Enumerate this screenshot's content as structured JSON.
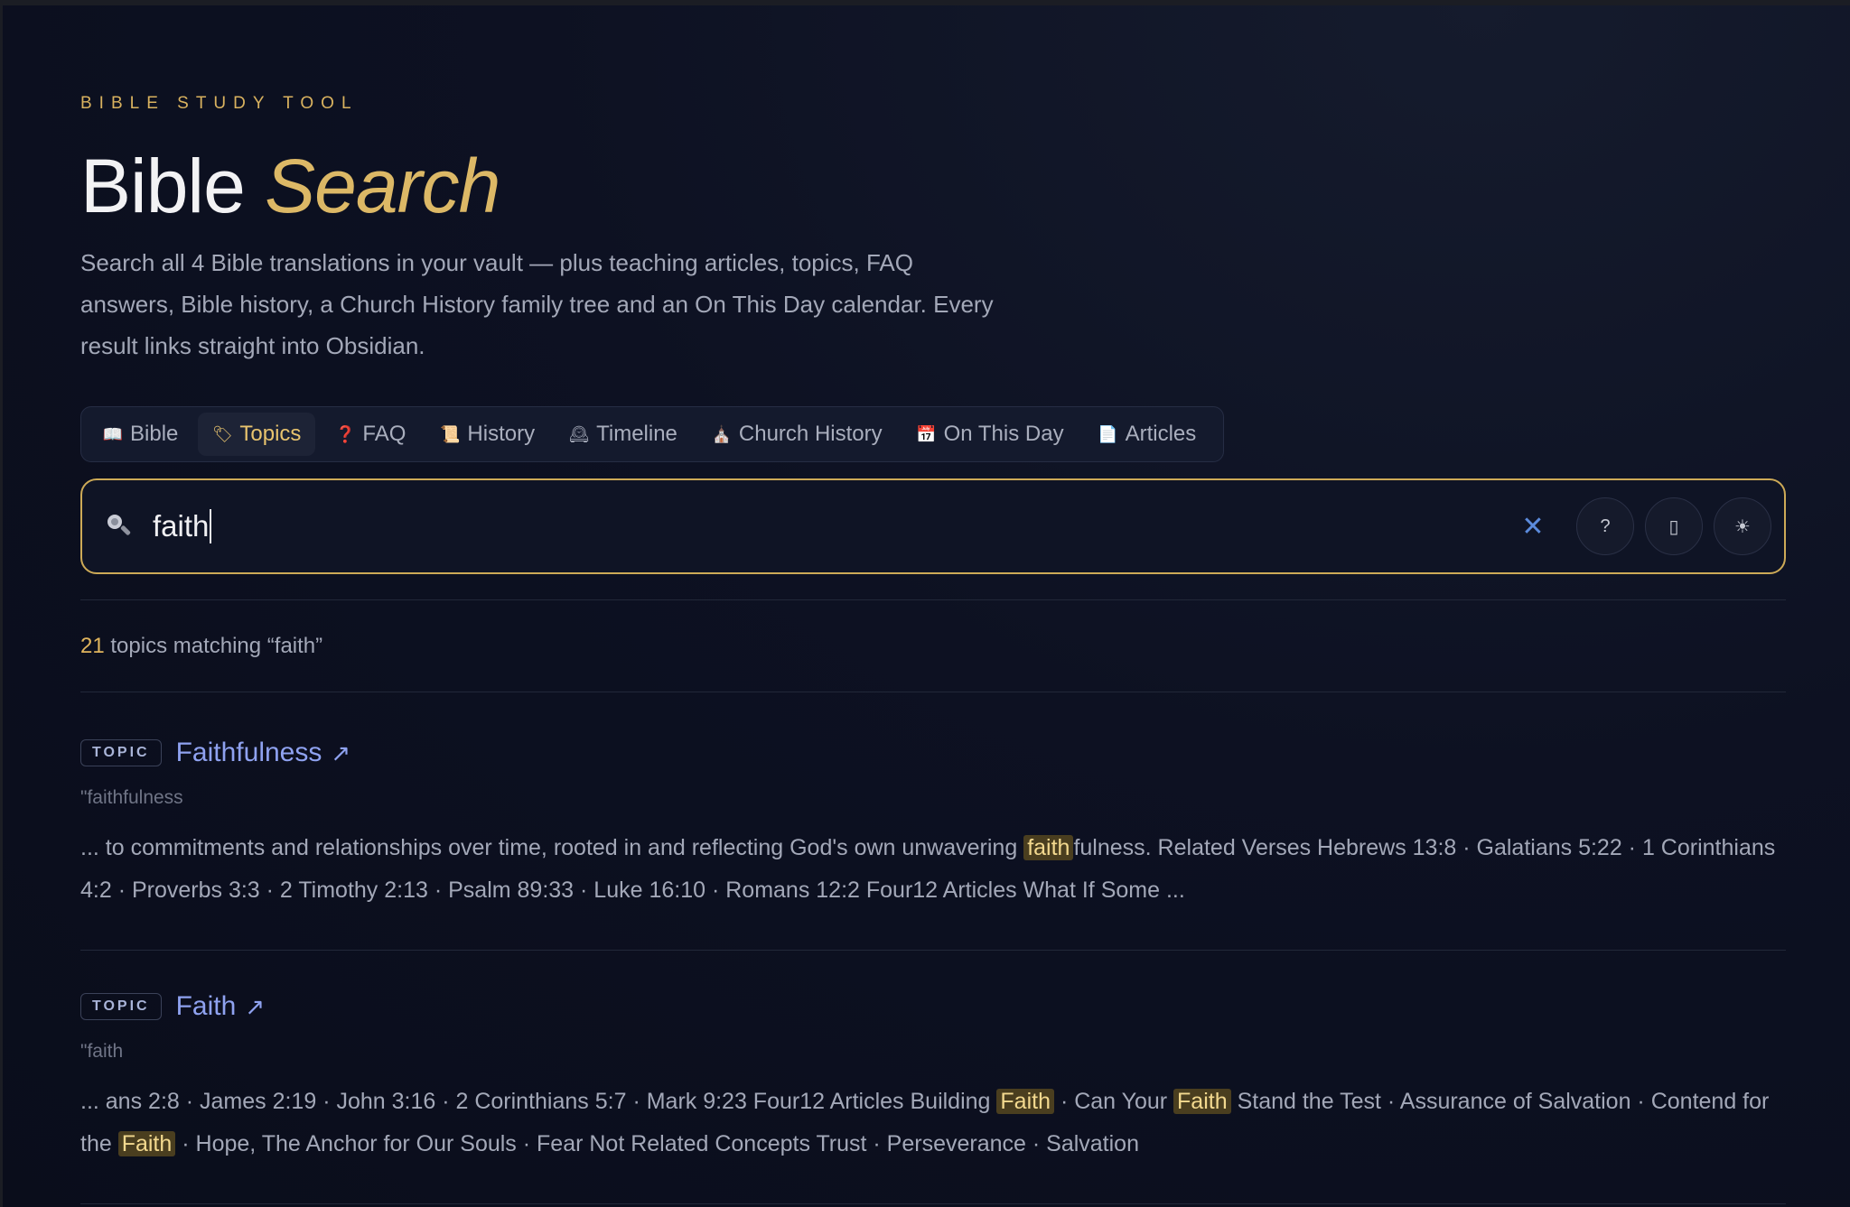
{
  "header": {
    "eyebrow": "BIBLE STUDY TOOL",
    "title_main": "Bible",
    "title_accent": "Search",
    "description": "Search all 4 Bible translations in your vault — plus teaching articles, topics, FAQ answers, Bible history, a Church History family tree and an On This Day calendar. Every result links straight into Obsidian."
  },
  "tabs": [
    {
      "label": "Bible",
      "icon": "book-icon",
      "glyph": "📖",
      "active": false
    },
    {
      "label": "Topics",
      "icon": "tag-icon",
      "glyph": "🏷",
      "active": true
    },
    {
      "label": "FAQ",
      "icon": "question-icon",
      "glyph": "❓",
      "active": false
    },
    {
      "label": "History",
      "icon": "scroll-icon",
      "glyph": "📜",
      "active": false
    },
    {
      "label": "Timeline",
      "icon": "clock-icon",
      "glyph": "🕰",
      "active": false
    },
    {
      "label": "Church History",
      "icon": "church-icon",
      "glyph": "⛪",
      "active": false
    },
    {
      "label": "On This Day",
      "icon": "calendar-icon",
      "glyph": "📅",
      "active": false
    },
    {
      "label": "Articles",
      "icon": "document-icon",
      "glyph": "📄",
      "active": false
    }
  ],
  "search": {
    "value": "faith",
    "clear_glyph": "✕",
    "help_glyph": "?",
    "layout_glyph": "▯",
    "theme_glyph": "☀"
  },
  "results_summary": {
    "count": "21",
    "text": " topics matching “faith”"
  },
  "results": [
    {
      "badge": "TOPIC",
      "title": "Faithfulness",
      "slug": "\"faithfulness",
      "snippet_parts": [
        {
          "t": "... to commitments and relationships over time, rooted in and reflecting God's own unwavering "
        },
        {
          "t": "faith",
          "hl": true
        },
        {
          "t": "fulness. Related Verses Hebrews 13:8 · Galatians 5:22 · 1 Corinthians 4:2 · Proverbs 3:3 · 2 Timothy 2:13 · Psalm 89:33 · Luke 16:10 · Romans 12:2 Four12 Articles What If Some ..."
        }
      ]
    },
    {
      "badge": "TOPIC",
      "title": "Faith",
      "slug": "\"faith",
      "snippet_parts": [
        {
          "t": "... ans 2:8 · James 2:19 · John 3:16 · 2 Corinthians 5:7 · Mark 9:23 Four12 Articles Building "
        },
        {
          "t": "Faith",
          "hl": true
        },
        {
          "t": " · Can Your "
        },
        {
          "t": "Faith",
          "hl": true
        },
        {
          "t": " Stand the Test · Assurance of Salvation · Contend for the "
        },
        {
          "t": "Faith",
          "hl": true
        },
        {
          "t": " · Hope, The Anchor for Our Souls · Fear Not Related Concepts Trust · Perseverance · Salvation"
        }
      ]
    }
  ],
  "colors": {
    "accent_gold": "#dcb866",
    "link_blue": "#8fa2f0",
    "highlight_bg": "#4a3e1f"
  }
}
